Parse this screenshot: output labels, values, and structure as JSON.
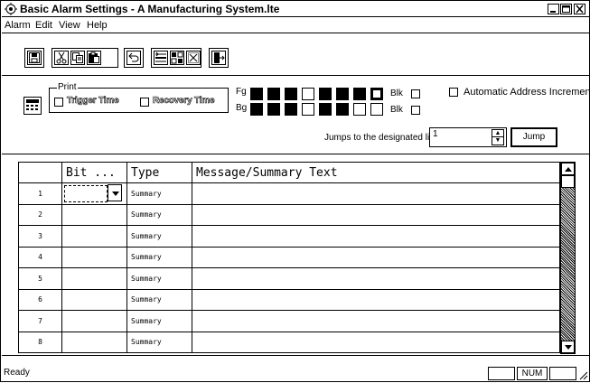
{
  "window": {
    "title": "Basic Alarm Settings - A Manufacturing System.lte"
  },
  "menu": {
    "items": [
      {
        "label": "Alarm"
      },
      {
        "label": "Edit"
      },
      {
        "label": "View"
      },
      {
        "label": "Help"
      }
    ]
  },
  "toolbar": {
    "icons": [
      "save-icon",
      "cut-icon",
      "copy-icon",
      "paste-icon",
      "undo-icon",
      "insert-line-icon",
      "delete-line-icon",
      "clear-icon",
      "exit-icon"
    ]
  },
  "options": {
    "print_legend": "Print",
    "trigger_time": "Trigger Time",
    "recovery_time": "Recovery Time",
    "fg_label": "Fg",
    "bg_label": "Bg",
    "blk_label": "Blk",
    "auto_increment": "Automatic Address Increment",
    "jump_label": "Jumps to the designated line",
    "jump_value": "1",
    "jump_button": "Jump"
  },
  "grid": {
    "headers": [
      "",
      "Bit ...",
      "Type",
      "Message/Summary Text"
    ],
    "rows": [
      {
        "num": "1",
        "bit": "",
        "type": "Summary",
        "message": ""
      },
      {
        "num": "2",
        "bit": "",
        "type": "Summary",
        "message": ""
      },
      {
        "num": "3",
        "bit": "",
        "type": "Summary",
        "message": ""
      },
      {
        "num": "4",
        "bit": "",
        "type": "Summary",
        "message": ""
      },
      {
        "num": "5",
        "bit": "",
        "type": "Summary",
        "message": ""
      },
      {
        "num": "6",
        "bit": "",
        "type": "Summary",
        "message": ""
      },
      {
        "num": "7",
        "bit": "",
        "type": "Summary",
        "message": ""
      },
      {
        "num": "8",
        "bit": "",
        "type": "Summary",
        "message": ""
      }
    ]
  },
  "status": {
    "text": "Ready",
    "num_indicator": "NUM"
  }
}
